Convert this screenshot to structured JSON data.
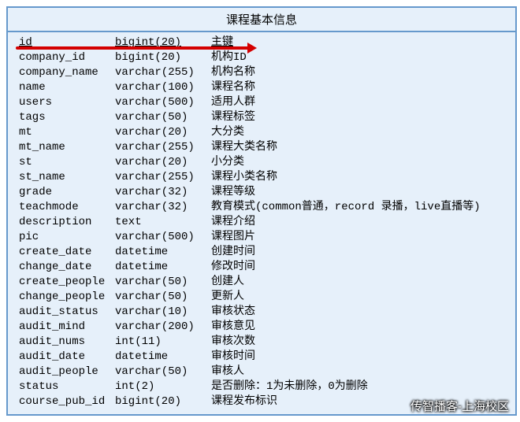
{
  "title": "课程基本信息",
  "columns": [
    {
      "field": "id",
      "type": "bigint(20)",
      "desc": "主键",
      "underline": true
    },
    {
      "field": "company_id",
      "type": "bigint(20)",
      "desc": "机构ID"
    },
    {
      "field": "company_name",
      "type": "varchar(255)",
      "desc": "机构名称"
    },
    {
      "field": "name",
      "type": "varchar(100)",
      "desc": "课程名称"
    },
    {
      "field": "users",
      "type": "varchar(500)",
      "desc": "适用人群"
    },
    {
      "field": "tags",
      "type": "varchar(50)",
      "desc": "课程标签"
    },
    {
      "field": "mt",
      "type": "varchar(20)",
      "desc": "大分类"
    },
    {
      "field": "mt_name",
      "type": "varchar(255)",
      "desc": "课程大类名称"
    },
    {
      "field": "st",
      "type": "varchar(20)",
      "desc": "小分类"
    },
    {
      "field": "st_name",
      "type": "varchar(255)",
      "desc": "课程小类名称"
    },
    {
      "field": "grade",
      "type": "varchar(32)",
      "desc": "课程等级"
    },
    {
      "field": "teachmode",
      "type": "varchar(32)",
      "desc": "教育模式(common普通，record 录播，live直播等)"
    },
    {
      "field": "description",
      "type": "text",
      "desc": "课程介绍"
    },
    {
      "field": "pic",
      "type": "varchar(500)",
      "desc": "课程图片"
    },
    {
      "field": "create_date",
      "type": "datetime",
      "desc": "创建时间"
    },
    {
      "field": "change_date",
      "type": "datetime",
      "desc": "修改时间"
    },
    {
      "field": "create_people",
      "type": "varchar(50)",
      "desc": "创建人"
    },
    {
      "field": "change_people",
      "type": "varchar(50)",
      "desc": "更新人"
    },
    {
      "field": "audit_status",
      "type": "varchar(10)",
      "desc": "审核状态"
    },
    {
      "field": "audit_mind",
      "type": "varchar(200)",
      "desc": "审核意见"
    },
    {
      "field": "audit_nums",
      "type": "int(11)",
      "desc": "审核次数"
    },
    {
      "field": "audit_date",
      "type": "datetime",
      "desc": "审核时间"
    },
    {
      "field": "audit_people",
      "type": "varchar(50)",
      "desc": "审核人"
    },
    {
      "field": "status",
      "type": "int(2)",
      "desc": "是否删除：1为未删除，0为删除"
    },
    {
      "field": "course_pub_id",
      "type": "bigint(20)",
      "desc": "课程发布标识"
    }
  ],
  "watermark": "传智播客-上海校区"
}
